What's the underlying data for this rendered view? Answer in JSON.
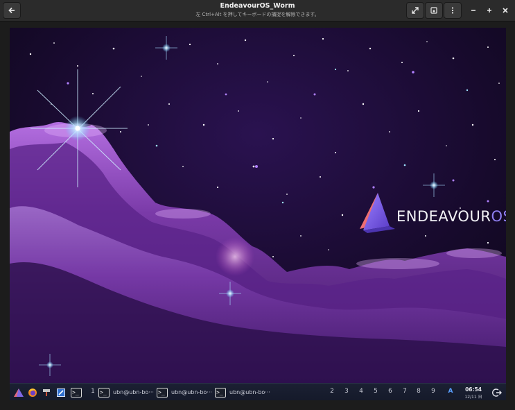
{
  "window": {
    "title": "EndeavourOS_Worm",
    "subtitle": "左 Ctrl+Alt を押してキーボードの捕捉を解除できます。",
    "buttons": {
      "back": "back-arrow-icon",
      "fullscreen": "expand-icon",
      "screenshot": "camera-icon",
      "menu": "kebab-menu-icon",
      "minimize": "minus-icon",
      "maximize": "plus-icon",
      "close": "close-icon"
    }
  },
  "desktop": {
    "logo_text_main": "ENDEAVOUR",
    "logo_text_accent": "OS",
    "colors": {
      "accent": "#7e68e6",
      "logo_text": "#f2f2f6",
      "logo_os": "#8f7ff0"
    }
  },
  "taskbar": {
    "launchers": [
      "app-launcher-icon",
      "firefox-icon",
      "file-manager-icon",
      "text-editor-icon",
      "terminal-icon"
    ],
    "terminal_glyph": ">_",
    "current_workspace": "1",
    "tasks": [
      {
        "label": "ubn@ubn-bo···",
        "icon": "terminal-icon"
      },
      {
        "label": "ubn@ubn-bo···",
        "icon": "terminal-icon"
      },
      {
        "label": "ubn@ubn-bo···",
        "icon": "terminal-icon"
      }
    ],
    "workspaces": [
      "2",
      "3",
      "4",
      "5",
      "6",
      "7",
      "8",
      "9"
    ],
    "keyboard_indicator": "A",
    "clock": {
      "time": "06:54",
      "date": "12/11 日"
    },
    "logout_icon": "logout-icon"
  }
}
